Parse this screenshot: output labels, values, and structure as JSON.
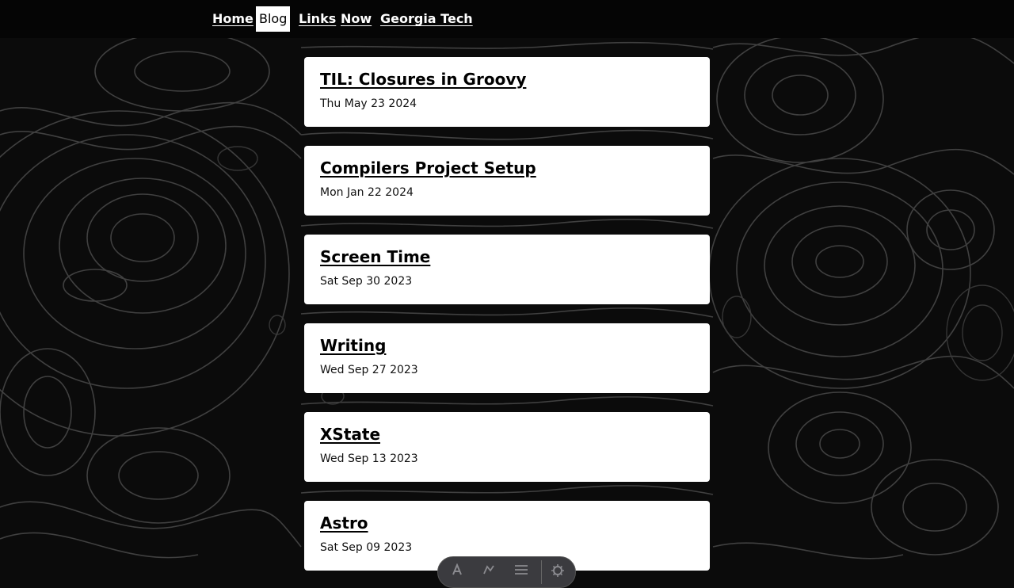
{
  "nav": {
    "items": [
      {
        "label": "Home"
      },
      {
        "label": "Blog"
      },
      {
        "label": "Links"
      },
      {
        "label": "Now"
      },
      {
        "label": "Georgia Tech"
      }
    ],
    "active": "Blog"
  },
  "posts": [
    {
      "title": "TIL: Closures in Groovy",
      "date": "Thu May 23 2024"
    },
    {
      "title": "Compilers Project Setup",
      "date": "Mon Jan 22 2024"
    },
    {
      "title": "Screen Time",
      "date": "Sat Sep 30 2023"
    },
    {
      "title": "Writing",
      "date": "Wed Sep 27 2023"
    },
    {
      "title": "XState",
      "date": "Wed Sep 13 2023"
    },
    {
      "title": "Astro",
      "date": "Sat Sep 09 2023"
    }
  ],
  "toolbar": {
    "icons": [
      "inspect-icon",
      "audit-icon",
      "menu-icon",
      "settings-icon"
    ]
  },
  "colors": {
    "background": "#0b0b0b",
    "contour_lines": "#5a5a5a",
    "card": "#ffffff",
    "nav_bar": "#050505"
  }
}
